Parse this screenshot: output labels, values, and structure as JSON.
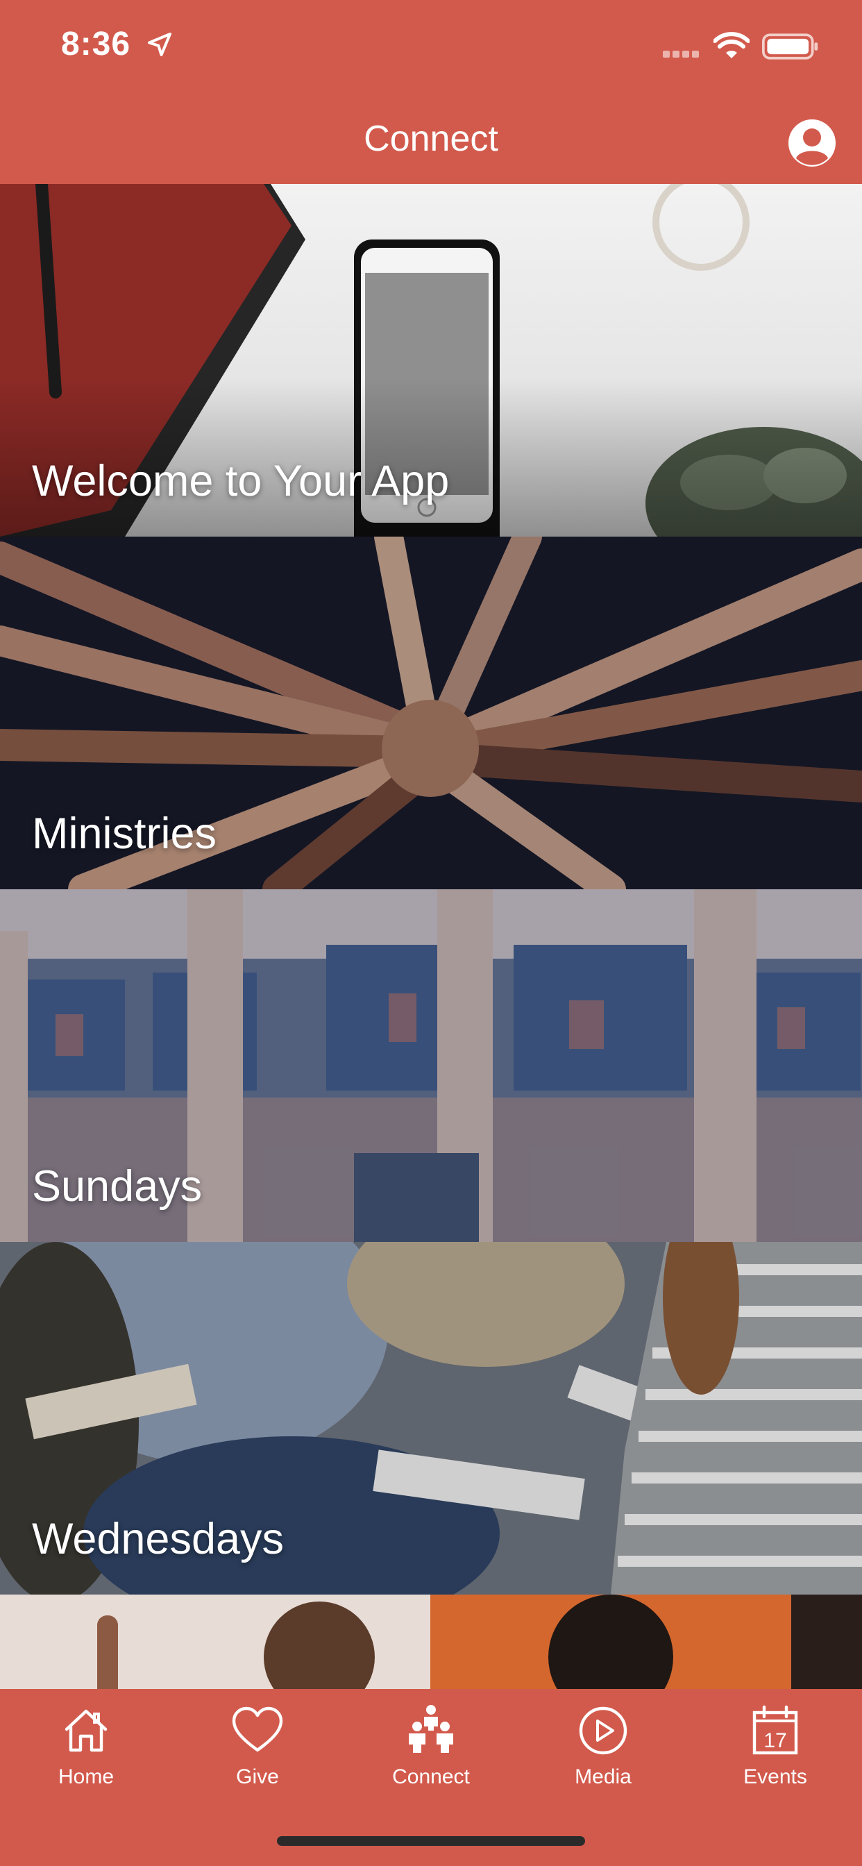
{
  "status_bar": {
    "time": "8:36"
  },
  "nav": {
    "title": "Connect"
  },
  "tiles": [
    {
      "label": "Welcome to Your App"
    },
    {
      "label": "Ministries"
    },
    {
      "label": "Sundays"
    },
    {
      "label": "Wednesdays"
    },
    {
      "label": ""
    }
  ],
  "tab_bar": {
    "items": [
      {
        "label": "Home",
        "icon": "home-icon"
      },
      {
        "label": "Give",
        "icon": "heart-icon"
      },
      {
        "label": "Connect",
        "icon": "people-icon",
        "active": true
      },
      {
        "label": "Media",
        "icon": "play-icon"
      },
      {
        "label": "Events",
        "icon": "calendar-icon",
        "day": "17"
      }
    ]
  },
  "colors": {
    "brand": "#d25a4c",
    "text": "#ffffff"
  }
}
